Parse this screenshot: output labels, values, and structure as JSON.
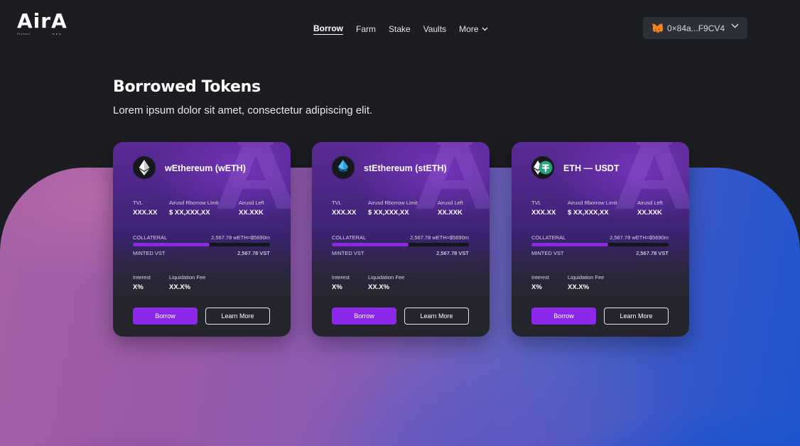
{
  "header": {
    "logo_text": "AirA",
    "logo_sub_left": "Protocol",
    "logo_sub_right": "● ● ●",
    "nav": [
      {
        "label": "Borrow",
        "active": true
      },
      {
        "label": "Farm"
      },
      {
        "label": "Stake"
      },
      {
        "label": "Vaults"
      },
      {
        "label": "More"
      }
    ],
    "wallet_address": "0×84a...F9CV4"
  },
  "hero": {
    "title": "Borrowed Tokens",
    "subtitle": "Lorem ipsum dolor sit amet, consectetur adipiscing elit."
  },
  "colors": {
    "accent": "#8b28ea",
    "background": "#1c1d21",
    "card_top": "#5a2a93",
    "card_bottom": "#25262d"
  },
  "cards": [
    {
      "token_name": "wEthereum (wETH)",
      "icon": "ethereum-icon",
      "tvl_label": "TVL",
      "tvl_value": "XXX.XX",
      "limit_label": "Airusd Rborrow Limit",
      "limit_value": "$ XX,XXX,XX",
      "left_label": "Airusd Left",
      "left_value": "XX.XXK",
      "collateral_label": "COLLATERAL",
      "collateral_value": "2,567.78 wETH≈$5690m",
      "collateral_fill": 0.56,
      "minted_label": "MINTED VST",
      "minted_value": "2,567.78 VST",
      "interest_label": "Interest",
      "interest_value": "X%",
      "fee_label": "Liquidation Fee",
      "fee_value": "XX.X%",
      "borrow_label": "Borrow",
      "learn_label": "Learn More"
    },
    {
      "token_name": "stEthereum (stETH)",
      "icon": "steth-drop-icon",
      "tvl_label": "TVL",
      "tvl_value": "XXX.XX",
      "limit_label": "Airusd Rborrow Limit",
      "limit_value": "$ XX,XXX,XX",
      "left_label": "Airusd Left",
      "left_value": "XX.XXK",
      "collateral_label": "COLLATERAL",
      "collateral_value": "2,567.78 wETH≈$5690m",
      "collateral_fill": 0.56,
      "minted_label": "MINTED VST",
      "minted_value": "2,567.78 VST",
      "interest_label": "Interest",
      "interest_value": "X%",
      "fee_label": "Liquidation Fee",
      "fee_value": "XX.X%",
      "borrow_label": "Borrow",
      "learn_label": "Learn More"
    },
    {
      "token_name": "ETH — USDT",
      "icon": "eth-usdt-pair-icon",
      "tvl_label": "TVL",
      "tvl_value": "XXX.XX",
      "limit_label": "Airusd Rborrow Limit",
      "limit_value": "$ XX,XXX,XX",
      "left_label": "Airusd Left",
      "left_value": "XX.XXK",
      "collateral_label": "COLLATERAL",
      "collateral_value": "2,567.78 wETH≈$5690m",
      "collateral_fill": 0.56,
      "minted_label": "MINTED VST",
      "minted_value": "2,567.78 VST",
      "interest_label": "Interest",
      "interest_value": "X%",
      "fee_label": "Liquidation Fee",
      "fee_value": "XX.X%",
      "borrow_label": "Borrow",
      "learn_label": "Learn More"
    }
  ]
}
